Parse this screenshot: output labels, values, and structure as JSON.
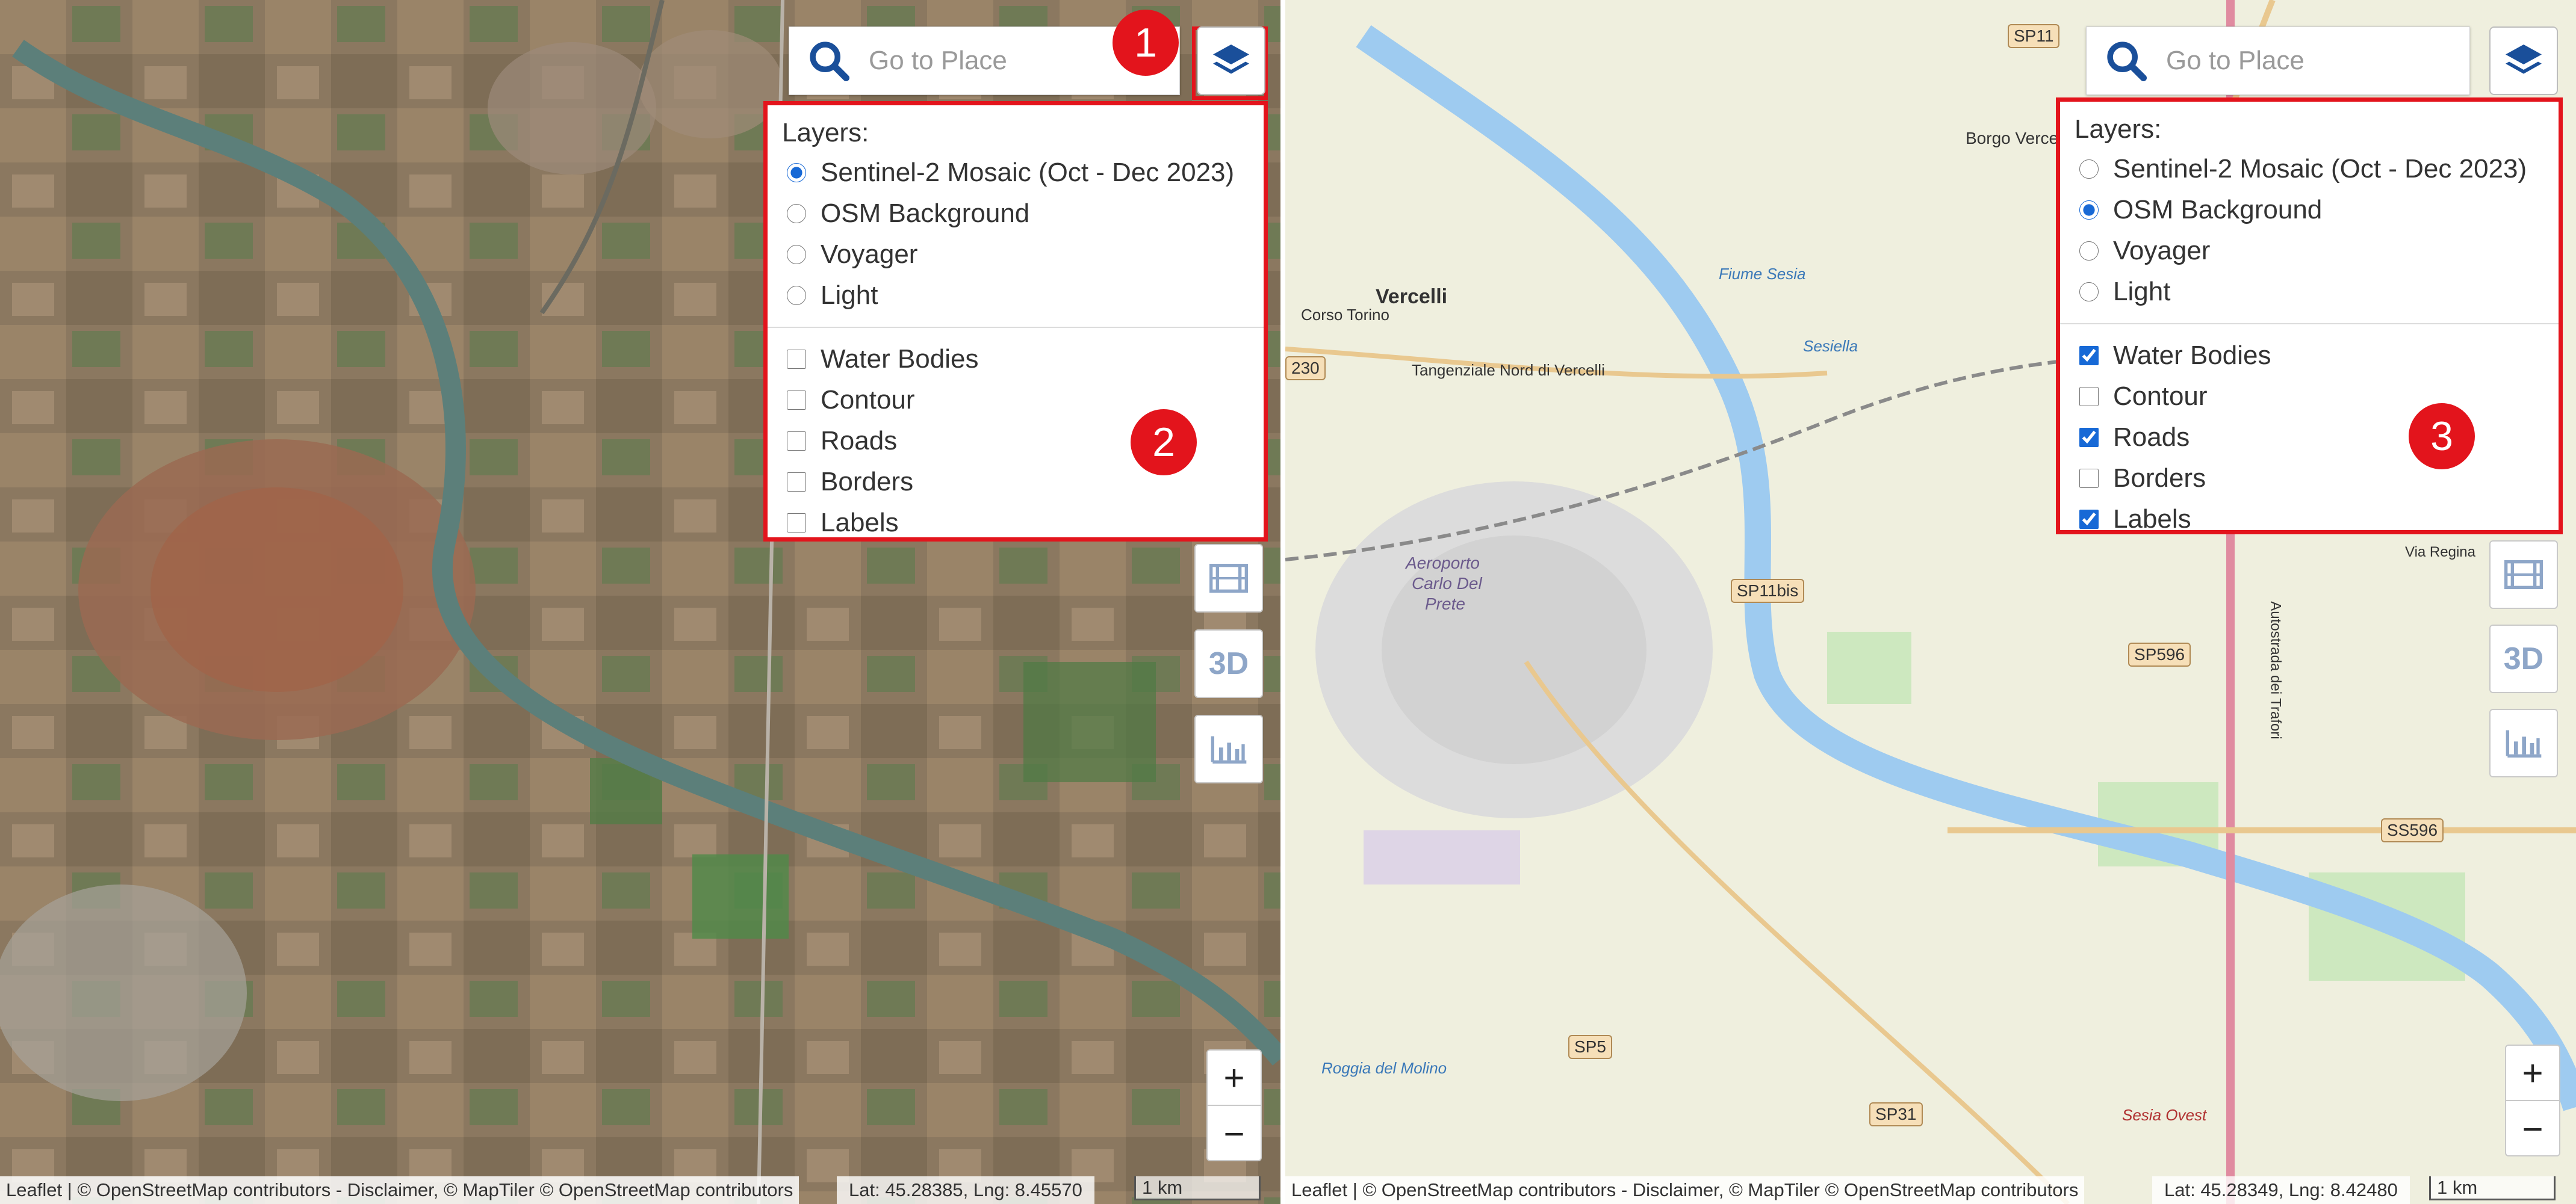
{
  "search": {
    "placeholder": "Go to Place"
  },
  "callouts": {
    "one": "1",
    "two": "2",
    "three": "3"
  },
  "layers": {
    "title": "Layers:",
    "base": [
      "Sentinel-2 Mosaic (Oct - Dec 2023)",
      "OSM Background",
      "Voyager",
      "Light"
    ],
    "overlays": [
      "Water Bodies",
      "Contour",
      "Roads",
      "Borders",
      "Labels"
    ]
  },
  "left": {
    "selected_base": "Sentinel-2 Mosaic (Oct - Dec 2023)",
    "checked_overlays": [],
    "coords": "Lat: 45.28385, Lng: 8.45570"
  },
  "right": {
    "selected_base": "OSM Background",
    "checked_overlays": [
      "Water Bodies",
      "Roads",
      "Labels"
    ],
    "coords": "Lat: 45.28349, Lng: 8.42480"
  },
  "controls": {
    "three_d": "3D",
    "zoom_in": "+",
    "zoom_out": "−"
  },
  "attribution": "Leaflet | © OpenStreetMap contributors - Disclaimer, © MapTiler © OpenStreetMap contributors",
  "scale": "1 km",
  "map_labels": {
    "city": "Vercelli",
    "corso_torino": "Corso Torino",
    "airport_1": "Aeroporto",
    "airport_2": "Carlo Del",
    "airport_3": "Prete",
    "tangenziale": "Tangenziale Nord di Vercelli",
    "borgo": "Borgo Vercelli",
    "fiume_sesia": "Fiume Sesia",
    "sesiella": "Sesiella",
    "raggia_molino": "Roggia del Molino",
    "sesia_ovest": "Sesia Ovest",
    "autostrada": "Autostrada dei Trafori",
    "via_regina": "Via Regina"
  },
  "road_shields": {
    "sp11": "SP11",
    "sp11bis": "SP11bis",
    "sp596": "SP596",
    "ss596": "SS596",
    "sp5": "SP5",
    "sp31": "SP31",
    "s230": "230"
  },
  "colors": {
    "callout_red": "#e3141c",
    "search_icon": "#1a4f9a",
    "river_osm": "#9ecbf0",
    "river_sat": "#5c7f7a"
  }
}
